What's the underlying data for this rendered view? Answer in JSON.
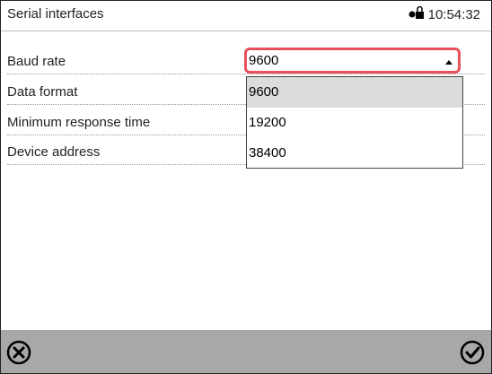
{
  "header": {
    "title": "Serial interfaces",
    "time": "10:54:32",
    "lock_icon": "lock-icon"
  },
  "rows": [
    {
      "label": "Baud rate"
    },
    {
      "label": "Data format"
    },
    {
      "label": "Minimum response time"
    },
    {
      "label": "Device address"
    }
  ],
  "baud_select": {
    "value": "9600",
    "options": [
      "9600",
      "19200",
      "38400"
    ],
    "selected_index": 0
  },
  "footer": {
    "cancel_icon": "cancel-icon",
    "confirm_icon": "checkmark-icon"
  },
  "colors": {
    "highlight_border": "#e8505b",
    "footer_bg": "#a8a8a8",
    "selected_option_bg": "#dcdcdc"
  }
}
